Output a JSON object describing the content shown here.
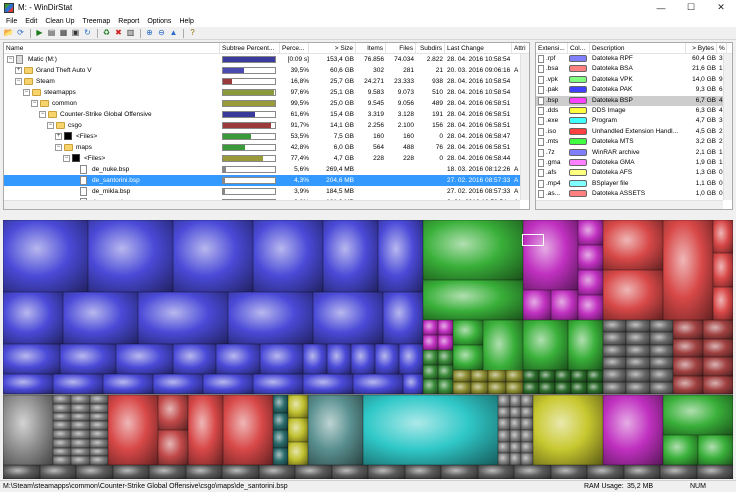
{
  "window": {
    "title": "M: - WinDirStat",
    "minimize": "—",
    "maximize": "☐",
    "close": "✕"
  },
  "menu": [
    "File",
    "Edit",
    "Clean Up",
    "Treemap",
    "Report",
    "Options",
    "Help"
  ],
  "toolbar": [
    {
      "name": "open-icon",
      "glyph": "📂"
    },
    {
      "name": "refresh-icon",
      "glyph": "⟳"
    },
    {
      "sep": true
    },
    {
      "name": "play-icon",
      "glyph": "▶"
    },
    {
      "name": "copy-path-icon",
      "glyph": "▤"
    },
    {
      "name": "explorer-icon",
      "glyph": "▦"
    },
    {
      "name": "cmd-icon",
      "glyph": "▣"
    },
    {
      "name": "refresh-selected-icon",
      "glyph": "↻"
    },
    {
      "sep": true
    },
    {
      "name": "recycle-icon",
      "glyph": "♻"
    },
    {
      "name": "delete-icon",
      "glyph": "✖"
    },
    {
      "name": "properties-icon",
      "glyph": "▥"
    },
    {
      "sep": true
    },
    {
      "name": "zoom-in-icon",
      "glyph": "⊕"
    },
    {
      "name": "zoom-out-icon",
      "glyph": "⊖"
    },
    {
      "name": "select-parent-icon",
      "glyph": "▲"
    },
    {
      "sep": true
    },
    {
      "name": "help-icon",
      "glyph": "?"
    }
  ],
  "tree_columns": [
    "Name",
    "Subtree Percent...",
    "Perce...",
    "> Size",
    "Items",
    "Files",
    "Subdirs",
    "Last Change",
    "Attri"
  ],
  "tree_rows": [
    {
      "indent": 0,
      "icon": "drive",
      "exp": "−",
      "name": "Matic (M:)",
      "pct_fill": 1.0,
      "pct_color": "#3b3b9e",
      "percent": "[0:09 s]",
      "size": "153,4 GB",
      "items": "76.856",
      "files": "74.034",
      "subdirs": "2.822",
      "last": "28. 04. 2016  10:58:54",
      "attr": ""
    },
    {
      "indent": 1,
      "icon": "folder",
      "exp": "+",
      "name": "Grand Theft Auto V",
      "pct_fill": 0.395,
      "pct_color": "#4a4ab0",
      "percent": "39,5%",
      "size": "60,6 GB",
      "items": "302",
      "files": "281",
      "subdirs": "21",
      "last": "20. 03. 2016  09:06:16",
      "attr": "A"
    },
    {
      "indent": 1,
      "icon": "folder",
      "exp": "−",
      "name": "Steam",
      "pct_fill": 0.168,
      "pct_color": "#9a3a3a",
      "percent": "16,8%",
      "size": "25,7 GB",
      "items": "24.271",
      "files": "23.333",
      "subdirs": "938",
      "last": "28. 04. 2016  10:58:54",
      "attr": ""
    },
    {
      "indent": 2,
      "icon": "folder",
      "exp": "−",
      "name": "steamapps",
      "pct_fill": 0.976,
      "pct_color": "#8a9a3a",
      "percent": "97,6%",
      "size": "25,1 GB",
      "items": "9.583",
      "files": "9.073",
      "subdirs": "510",
      "last": "28. 04. 2016  10:58:54",
      "attr": ""
    },
    {
      "indent": 3,
      "icon": "folder",
      "exp": "−",
      "name": "common",
      "pct_fill": 0.995,
      "pct_color": "#9a9a3a",
      "percent": "99,5%",
      "size": "25,0 GB",
      "items": "9.545",
      "files": "9.056",
      "subdirs": "489",
      "last": "28. 04. 2016  06:58:51",
      "attr": ""
    },
    {
      "indent": 4,
      "icon": "folder",
      "exp": "−",
      "name": "Counter-Strike Global Offensive",
      "pct_fill": 0.616,
      "pct_color": "#3a3a9a",
      "percent": "61,6%",
      "size": "15,4 GB",
      "items": "3.319",
      "files": "3.128",
      "subdirs": "191",
      "last": "28. 04. 2016  06:58:51",
      "attr": ""
    },
    {
      "indent": 5,
      "icon": "folder",
      "exp": "−",
      "name": "csgo",
      "pct_fill": 0.917,
      "pct_color": "#9a3a3a",
      "percent": "91,7%",
      "size": "14,1 GB",
      "items": "2.256",
      "files": "2.100",
      "subdirs": "156",
      "last": "28. 04. 2016  06:58:51",
      "attr": ""
    },
    {
      "indent": 6,
      "icon": "black",
      "exp": "+",
      "name": "<Files>",
      "pct_fill": 0.535,
      "pct_color": "#3a9a3a",
      "percent": "53,5%",
      "size": "7,5 GB",
      "items": "160",
      "files": "160",
      "subdirs": "0",
      "last": "28. 04. 2016  06:58:47",
      "attr": ""
    },
    {
      "indent": 6,
      "icon": "folder",
      "exp": "−",
      "name": "maps",
      "pct_fill": 0.428,
      "pct_color": "#3a9a3a",
      "percent": "42,8%",
      "size": "6,0 GB",
      "items": "564",
      "files": "488",
      "subdirs": "76",
      "last": "28. 04. 2016  06:58:51",
      "attr": ""
    },
    {
      "indent": 7,
      "icon": "black",
      "exp": "−",
      "name": "<Files>",
      "pct_fill": 0.774,
      "pct_color": "#9a9a3a",
      "percent": "77,4%",
      "size": "4,7 GB",
      "items": "228",
      "files": "228",
      "subdirs": "0",
      "last": "28. 04. 2016  06:58:44",
      "attr": ""
    },
    {
      "indent": 8,
      "icon": "file",
      "exp": "",
      "name": "de_nuke.bsp",
      "pct_fill": 0.056,
      "pct_color": "#888",
      "percent": "5,6%",
      "size": "269,4 MB",
      "items": "",
      "files": "",
      "subdirs": "",
      "last": "18. 03. 2016  08:12:26",
      "attr": "A"
    },
    {
      "indent": 8,
      "icon": "file",
      "exp": "",
      "name": "de_santorini.bsp",
      "pct_fill": 0.043,
      "pct_color": "#888",
      "percent": "4,3%",
      "size": "204,6 MB",
      "items": "",
      "files": "",
      "subdirs": "",
      "last": "27. 02. 2016  08:57:33",
      "attr": "A",
      "selected": true
    },
    {
      "indent": 8,
      "icon": "file",
      "exp": "",
      "name": "de_mikla.bsp",
      "pct_fill": 0.039,
      "pct_color": "#888",
      "percent": "3,9%",
      "size": "184,5 MB",
      "items": "",
      "files": "",
      "subdirs": "",
      "last": "27. 02. 2016  08:57:33",
      "attr": "A"
    },
    {
      "indent": 8,
      "icon": "file",
      "exp": "",
      "name": "de_resort.bsp",
      "pct_fill": 0.038,
      "pct_color": "#888",
      "percent": "3,8%",
      "size": "181,9 MB",
      "items": "",
      "files": "",
      "subdirs": "",
      "last": "3. 01. 2016  10:58:54",
      "attr": "A"
    }
  ],
  "ext_columns": [
    "Extensi...",
    "Col...",
    "Description",
    "> Bytes",
    "%"
  ],
  "ext_rows": [
    {
      "ext": ".rpf",
      "color": "#8080ff",
      "desc": "Datoteka RPF",
      "bytes": "60,4 GB",
      "pct": "3"
    },
    {
      "ext": ".bsa",
      "color": "#ff8080",
      "desc": "Datoteka BSA",
      "bytes": "21,6 GB",
      "pct": "1"
    },
    {
      "ext": ".vpk",
      "color": "#80ff80",
      "desc": "Datoteka VPK",
      "bytes": "14,0 GB",
      "pct": "9"
    },
    {
      "ext": ".pak",
      "color": "#4040ff",
      "desc": "Datoteka PAK",
      "bytes": "9,3 GB",
      "pct": "6"
    },
    {
      "ext": ".bsp",
      "color": "#ff40ff",
      "desc": "Datoteka BSP",
      "bytes": "6,7 GB",
      "pct": "4",
      "gray": true
    },
    {
      "ext": ".dds",
      "color": "#ffff40",
      "desc": "DDS Image",
      "bytes": "6,3 GB",
      "pct": "4"
    },
    {
      "ext": ".exe",
      "color": "#40ffff",
      "desc": "Program",
      "bytes": "4,7 GB",
      "pct": "3"
    },
    {
      "ext": ".iso",
      "color": "#ff4040",
      "desc": "Unhandled Extension Handl...",
      "bytes": "4,5 GB",
      "pct": "2"
    },
    {
      "ext": ".mts",
      "color": "#40ff40",
      "desc": "Datoteka MTS",
      "bytes": "3,2 GB",
      "pct": "2"
    },
    {
      "ext": ".7z",
      "color": "#8080ff",
      "desc": "WinRAR archive",
      "bytes": "2,1 GB",
      "pct": "1"
    },
    {
      "ext": ".gma",
      "color": "#ff80ff",
      "desc": "Datoteka GMA",
      "bytes": "1,9 GB",
      "pct": "1"
    },
    {
      "ext": ".afs",
      "color": "#ffff80",
      "desc": "Datoteka AFS",
      "bytes": "1,3 GB",
      "pct": "0"
    },
    {
      "ext": ".mp4",
      "color": "#80ffff",
      "desc": "BSplayer file",
      "bytes": "1,1 GB",
      "pct": "0"
    },
    {
      "ext": ".as...",
      "color": "#ff8080",
      "desc": "Datoteka ASSETS",
      "bytes": "1,0 GB",
      "pct": "0"
    },
    {
      "ext": ".dll",
      "color": "#8080ff",
      "desc": "Razširitev programa",
      "bytes": "990,3 MB",
      "pct": "0"
    }
  ],
  "status": {
    "path": "M:\\Steam\\steamapps\\common\\Counter-Strike Global Offensive\\csgo\\maps\\de_santorini.bsp",
    "ram": "RAM Usage:",
    "ram_value": "35,2 MB",
    "num": "NUM"
  }
}
